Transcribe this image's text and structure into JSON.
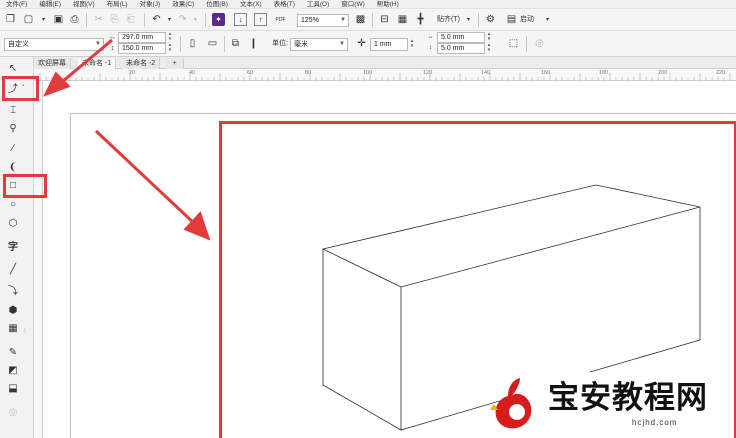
{
  "menu": [
    "文件(F)",
    "编辑(E)",
    "视图(V)",
    "布局(L)",
    "对象(J)",
    "效果(C)",
    "位图(B)",
    "文本(X)",
    "表格(T)",
    "工具(O)",
    "窗口(W)",
    "帮助(H)"
  ],
  "toolbar": {
    "zoom_value": "125%",
    "snap_label": "贴齐(T)",
    "launch_label": "启动"
  },
  "property_bar": {
    "page_preset": "自定义",
    "width": "297.0 mm",
    "height": "150.0 mm",
    "units_label": "单位:",
    "units_value": "毫米",
    "nudge_value": "1 mm",
    "dup_x": "5.0 mm",
    "dup_y": "5.0 mm"
  },
  "tabs": [
    "欢迎屏幕",
    "未命名 -1",
    "未命名 -2"
  ],
  "ruler_labels": [
    "20",
    "40",
    "60",
    "80",
    "100",
    "120",
    "140",
    "160",
    "180",
    "200",
    "220"
  ],
  "toolbox": {
    "text_tool_glyph": "字"
  },
  "watermark": {
    "text": "宝安教程网",
    "url": "hcjhd.com"
  },
  "colors": {
    "highlight": "#e23b3b",
    "page_border": "#bdbdbd"
  }
}
